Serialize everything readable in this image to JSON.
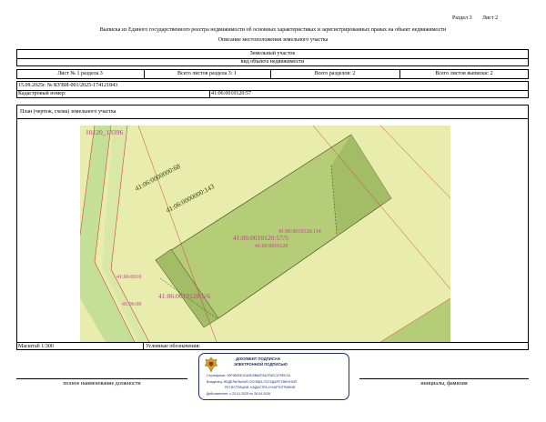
{
  "header": {
    "section_label": "Раздел 3",
    "sheet_label": "Лист 2",
    "title": "Выписка из Единого государственного реестра недвижимости об основных характеристиках и зарегистрированных правах на объект недвижимости",
    "subtitle": "Описание местоположения земельного участка"
  },
  "object": {
    "type": "Земельный участок",
    "type_caption": "вид объекта недвижимости"
  },
  "sheet_info": {
    "sheet_of_section": "Лист № 1 раздела 3",
    "sheets_in_section": "Всего листов раздела 3: 1",
    "total_sections": "Всего разделов: 2",
    "total_sheets": "Всего листов выписки: 2"
  },
  "record": {
    "date_number": "15.09.2025г. № КУВИ-001/2025-174121843",
    "cadastral_label": "Кадастровый номер:",
    "cadastral_number": "41:06:0010120:57"
  },
  "plan": {
    "heading": "План (чертеж, схема) земельного участка",
    "labels": {
      "block": "10120_13396",
      "parcel_68": "41:06:0000000:68",
      "parcel_143": "41:06:0000000:143",
      "main_parcel": "41:06:0010120:57/5",
      "main_parcel_sub": "41:06:0010120",
      "right_parcel": "41:06:0010120:114",
      "bottom_parcel": "41:06:0010120:5/6",
      "left_parcel_a": "41:06:0010",
      "left_parcel_b": "41:06:00"
    }
  },
  "footer": {
    "scale": "Масштаб 1:300",
    "legend_label": "Условные обозначения:",
    "position_caption": "полное наименование должности",
    "signature_caption": "инициалы, фамилия"
  },
  "stamp": {
    "title_line1": "ДОКУМЕНТ ПОДПИСАН",
    "title_line2": "ЭЛЕКТРОННОЙ ПОДПИСЬЮ",
    "certificate": "Сертификат: 00F960EE1DA9D3B60F8A7F82C1F9EE1A",
    "owner_line1": "Владелец: ФЕДЕРАЛЬНАЯ СЛУЖБА ГОСУДАРСТВЕННОЙ",
    "owner_line2": "РЕГИСТРАЦИИ, КАДАСТРА И КАРТОГРАФИИ",
    "validity": "Действителен: с 22.01.2025 по 26.04.2026"
  },
  "colors": {
    "plan_background": "#e8ecac",
    "main_parcel": "#b6cd78",
    "main_parcel_dark": "#a2bd66",
    "road_strip": "#c3e096",
    "label_magenta": "#c23a92",
    "label_dark": "#2d3d0e",
    "stamp_blue": "#1f2c7a"
  }
}
